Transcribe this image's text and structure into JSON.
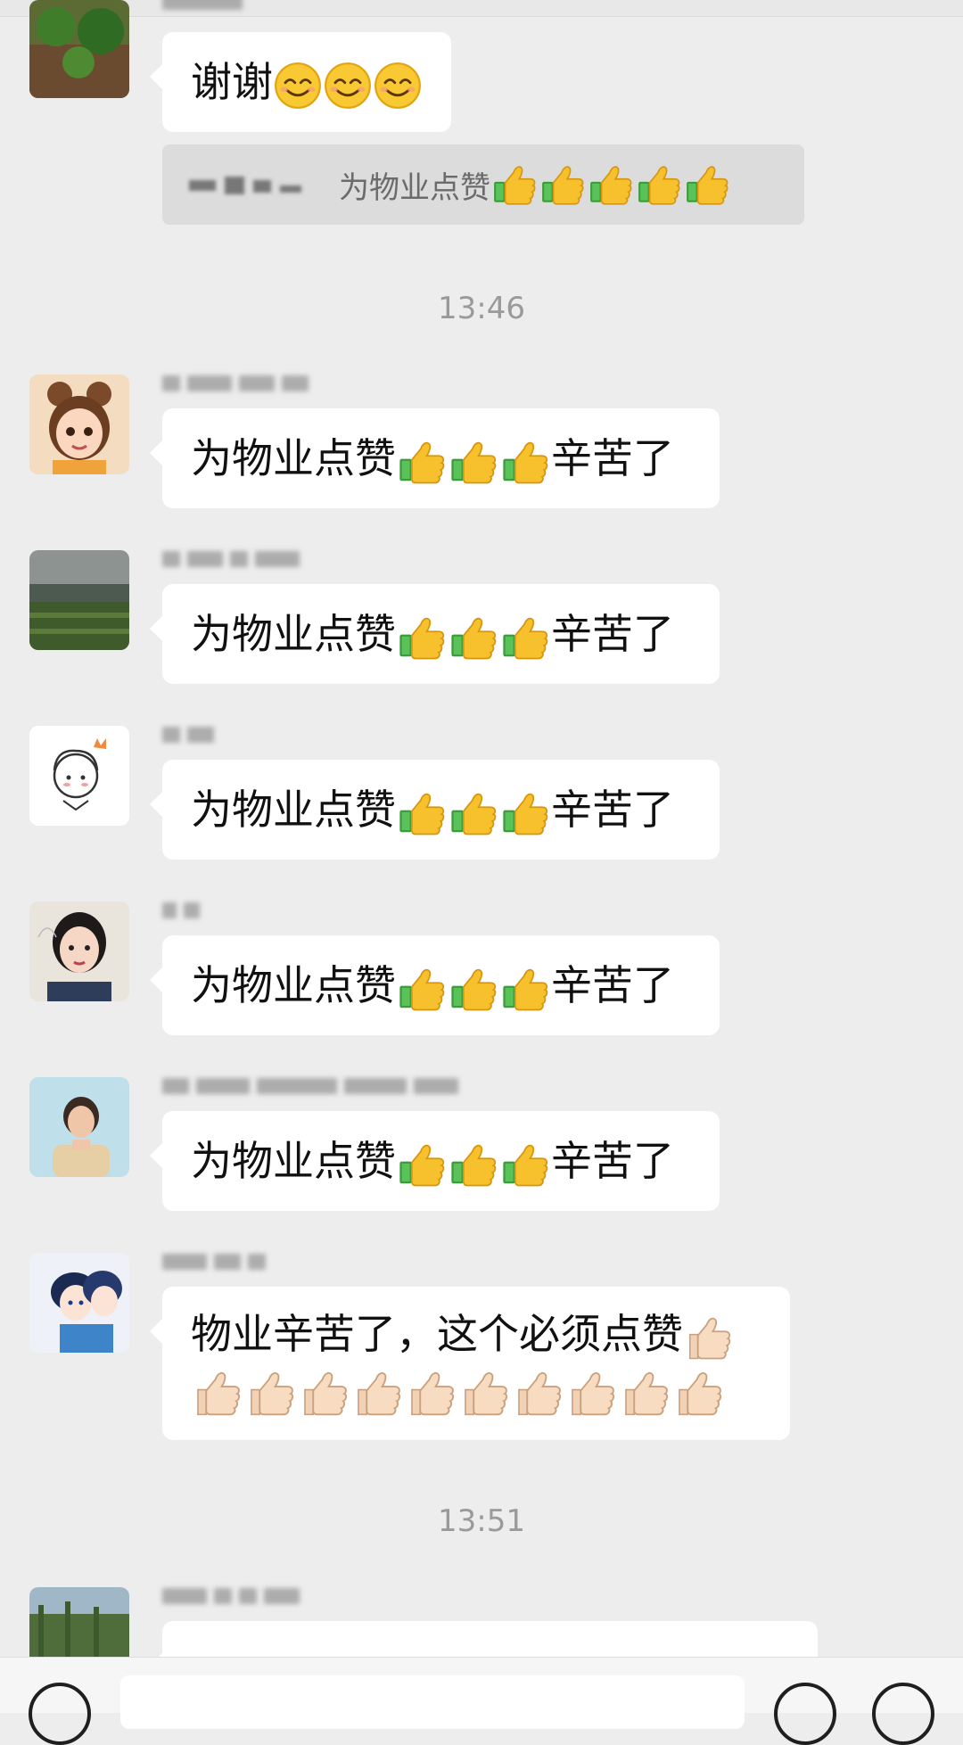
{
  "messages": {
    "m0": {
      "text": "谢谢"
    },
    "sys": {
      "text": "为物业点赞"
    },
    "t1": "13:46",
    "m1": {
      "text": "为物业点赞",
      "suffix": "辛苦了"
    },
    "m2": {
      "text": "为物业点赞",
      "suffix": "辛苦了"
    },
    "m3": {
      "text": "为物业点赞",
      "suffix": "辛苦了"
    },
    "m4": {
      "text": "为物业点赞",
      "suffix": "辛苦了"
    },
    "m5": {
      "text": "为物业点赞",
      "suffix": "辛苦了"
    },
    "m6": {
      "line1": "物业辛苦了，这个必须点赞"
    },
    "t2": "13:51"
  },
  "icons": {
    "smile": "smiling-face-emoji",
    "thumb": "thumbs-up-emoji",
    "voice": "voice-icon",
    "emoji_btn": "emoji-icon",
    "plus": "plus-icon"
  },
  "colors": {
    "background": "#ededed",
    "bubble": "#ffffff",
    "system_bar": "#dcdcdc",
    "time_text": "#9a9a9a"
  }
}
